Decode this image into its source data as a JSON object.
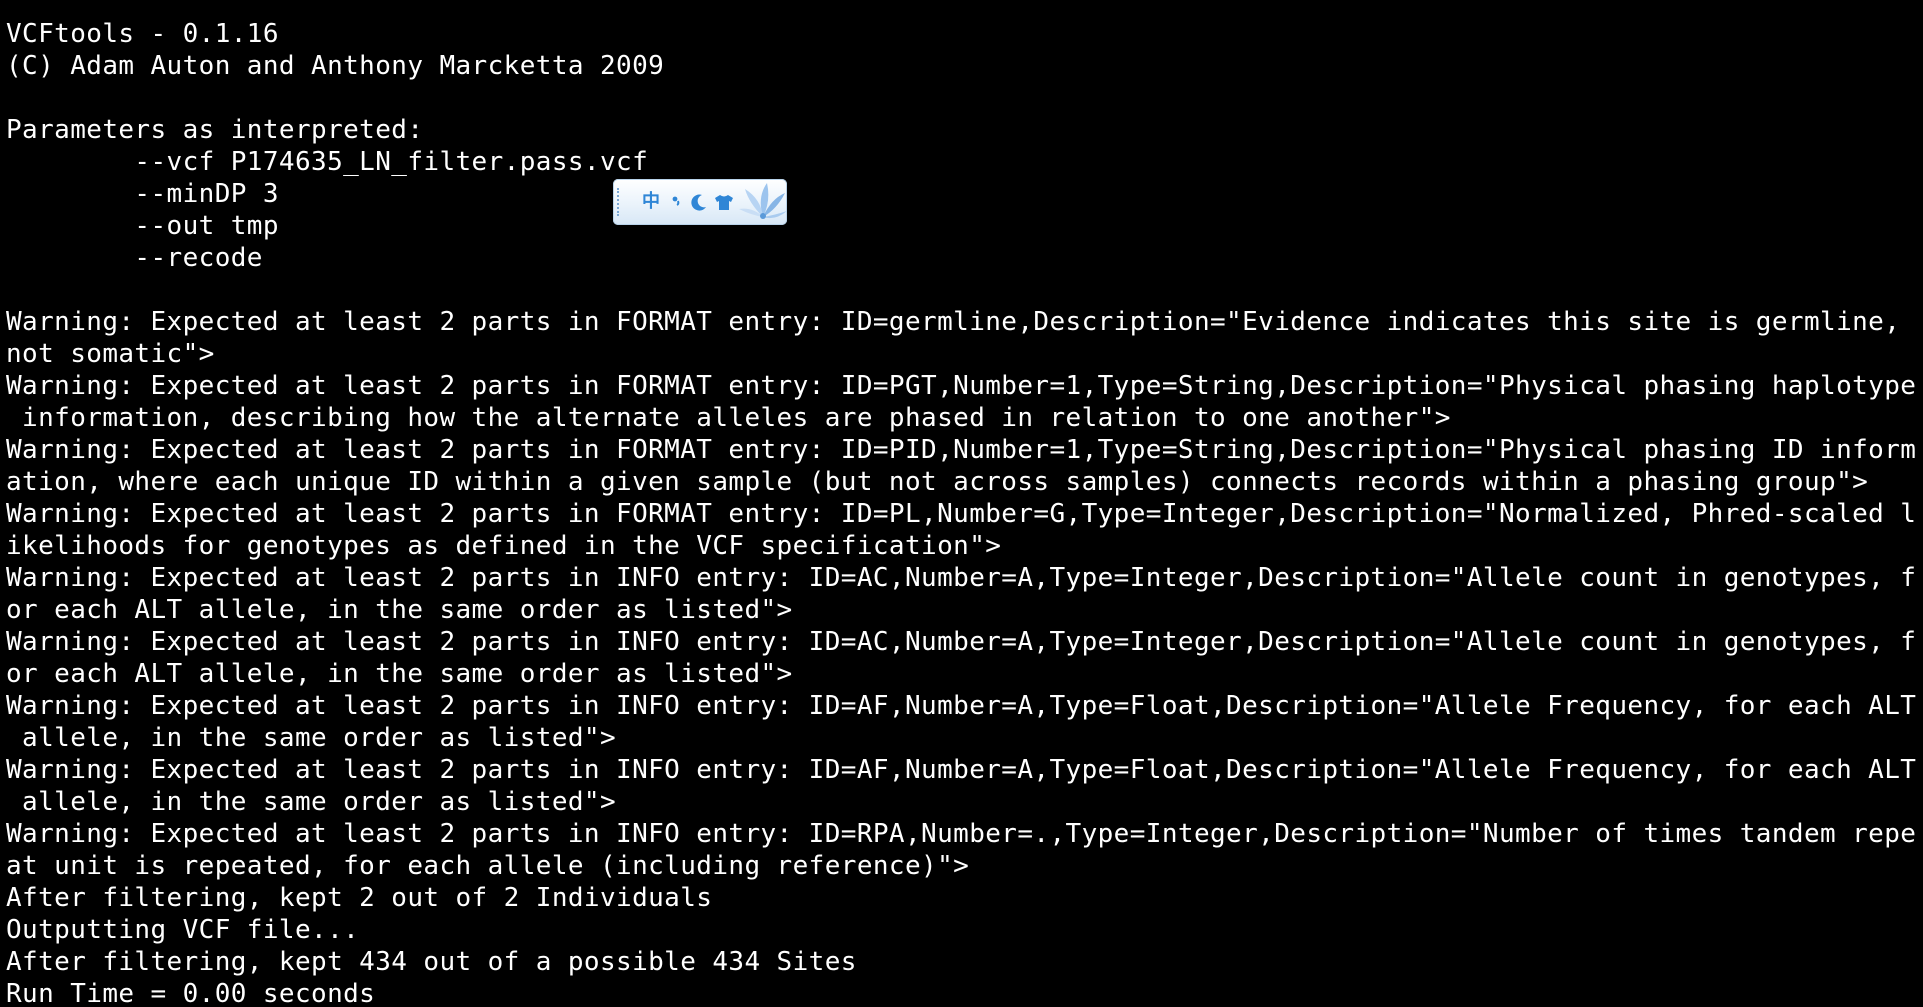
{
  "terminal": {
    "lines": [
      "VCFtools - 0.1.16",
      "(C) Adam Auton and Anthony Marcketta 2009",
      "",
      "Parameters as interpreted:",
      "        --vcf P174635_LN_filter.pass.vcf",
      "        --minDP 3",
      "        --out tmp",
      "        --recode",
      "",
      "Warning: Expected at least 2 parts in FORMAT entry: ID=germline,Description=\"Evidence indicates this site is germline,",
      "not somatic\">",
      "Warning: Expected at least 2 parts in FORMAT entry: ID=PGT,Number=1,Type=String,Description=\"Physical phasing haplotype",
      " information, describing how the alternate alleles are phased in relation to one another\">",
      "Warning: Expected at least 2 parts in FORMAT entry: ID=PID,Number=1,Type=String,Description=\"Physical phasing ID inform",
      "ation, where each unique ID within a given sample (but not across samples) connects records within a phasing group\">",
      "Warning: Expected at least 2 parts in FORMAT entry: ID=PL,Number=G,Type=Integer,Description=\"Normalized, Phred-scaled l",
      "ikelihoods for genotypes as defined in the VCF specification\">",
      "Warning: Expected at least 2 parts in INFO entry: ID=AC,Number=A,Type=Integer,Description=\"Allele count in genotypes, f",
      "or each ALT allele, in the same order as listed\">",
      "Warning: Expected at least 2 parts in INFO entry: ID=AC,Number=A,Type=Integer,Description=\"Allele count in genotypes, f",
      "or each ALT allele, in the same order as listed\">",
      "Warning: Expected at least 2 parts in INFO entry: ID=AF,Number=A,Type=Float,Description=\"Allele Frequency, for each ALT",
      " allele, in the same order as listed\">",
      "Warning: Expected at least 2 parts in INFO entry: ID=AF,Number=A,Type=Float,Description=\"Allele Frequency, for each ALT",
      " allele, in the same order as listed\">",
      "Warning: Expected at least 2 parts in INFO entry: ID=RPA,Number=.,Type=Integer,Description=\"Number of times tandem repe",
      "at unit is repeated, for each allele (including reference)\">",
      "After filtering, kept 2 out of 2 Individuals",
      "Outputting VCF file...",
      "After filtering, kept 434 out of a possible 434 Sites",
      "Run Time = 0.00 seconds"
    ]
  },
  "ime_toolbar": {
    "language_label": "中",
    "icons": [
      "punctuation-icon",
      "moon-icon",
      "shirt-icon",
      "flower-logo-icon"
    ]
  },
  "colors": {
    "background": "#000000",
    "text": "#ffffff",
    "ime_accent": "#2f86d6"
  }
}
